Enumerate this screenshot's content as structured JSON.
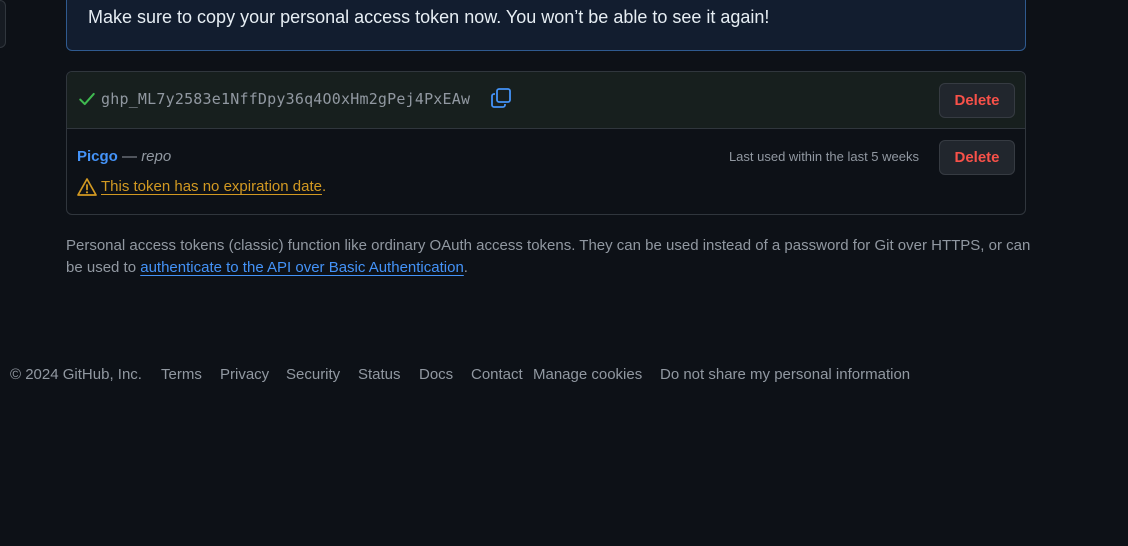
{
  "flash": {
    "message": "Make sure to copy your personal access token now. You won’t be able to see it again!"
  },
  "new_token": {
    "value": "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",
    "delete_label": "Delete",
    "check_icon": "check-icon",
    "copy_icon": "copy-icon"
  },
  "existing_token": {
    "name": "Picgo",
    "separator": "—",
    "scope": "repo",
    "last_used": "Last used within the last 5 weeks",
    "delete_label": "Delete",
    "warning_link": "This token has no expiration date",
    "warning_suffix": ".",
    "alert_icon": "alert-icon"
  },
  "description": {
    "text_before": "Personal access tokens (classic) function like ordinary OAuth access tokens. They can be used instead of a password for Git over HTTPS, or can be used to ",
    "link": "authenticate to the API over Basic Authentication",
    "text_after": "."
  },
  "footer": {
    "copyright": "© 2024 GitHub, Inc.",
    "links": [
      "Terms",
      "Privacy",
      "Security",
      "Status",
      "Docs",
      "Contact",
      "Manage cookies",
      "Do not share my personal information"
    ]
  },
  "colors": {
    "background": "#0d1117",
    "link": "#4493f8",
    "danger": "#f85149",
    "success": "#3fb950",
    "attention": "#d29922",
    "muted": "#9198a1"
  }
}
